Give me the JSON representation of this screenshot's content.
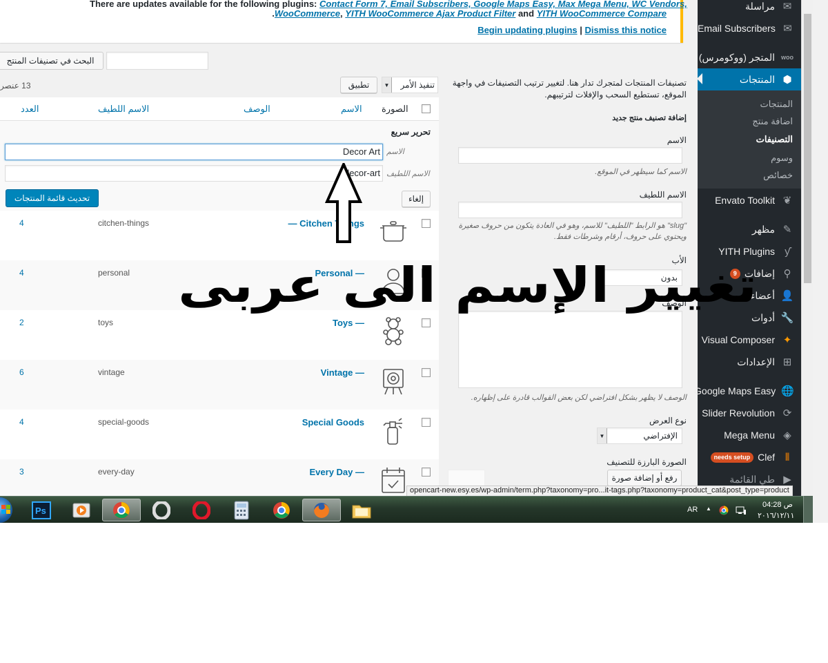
{
  "notice": {
    "line1": "There are updates available for the following plugins:",
    "line1_plugins": "Contact Form 7, Email Subscribers, Google Maps Easy, Max Mega Menu, WC Vendors,",
    "plugin_woocommerce": "WooCommerce",
    "plugin_ajax_filter": "YITH WooCommerce Ajax Product Filter",
    "and": "and",
    "plugin_compare": "YITH WooCommerce Compare",
    "begin_updating": "Begin updating plugins",
    "separator": "|",
    "dismiss": "Dismiss this notice"
  },
  "sidebar": {
    "items": {
      "messages": "مراسلة",
      "email_subscribers": "Email Subscribers",
      "woocommerce": "المتجر (ووكومرس)",
      "products": "المنتجات",
      "envato": "Envato Toolkit",
      "appearance": "مظهر",
      "yith": "YITH Plugins",
      "plugins": "إضافات",
      "plugins_count": "9",
      "users": "أعضاء",
      "tools": "أدوات",
      "visual_composer": "Visual Composer",
      "settings": "الإعدادات",
      "google_maps": "Google Maps Easy",
      "slider_revolution": "Slider Revolution",
      "mega_menu": "Mega Menu",
      "clef": "Clef",
      "clef_badge": "needs setup",
      "collapse": "طي القائمة"
    },
    "submenu": [
      "المنتجات",
      "اضافة منتج",
      "التصنيفات",
      "وسوم",
      "خصائص"
    ],
    "submenu_current": 2
  },
  "add_new": {
    "intro": "تصنيفات المنتجات لمتجرك تدار هنا. لتغيير ترتيب التصنيفات في واجهة الموقع، تستطيع السحب والإفلات لترتيبهم.",
    "heading": "إضافة تصنيف منتج جديد",
    "name_label": "الاسم",
    "name_desc": "الاسم كما سيظهر في الموقع.",
    "slug_label": "الاسم اللطيف",
    "slug_desc": "\"slug\" هو الرابط \"اللطيف\" للاسم، وهو في العادة يتكون من حروف صغيرة ويحتوي على حروف، أرقام وشرطات فقط.",
    "parent_label": "الأب",
    "parent_value": "بدون",
    "description_label": "الوصف",
    "description_desc": "الوصف لا يظهر بشكل افتراضي لكن بعض القوالب قادرة على إظهاره.",
    "display_type_label": "نوع العرض",
    "display_type_value": "الإفتراضي",
    "thumbnail_label": "الصورة البارزة للتصنيف",
    "upload_button": "رفع أو إضافة صورة"
  },
  "list": {
    "search_button": "البحث في تصنيفات المنتج",
    "bulk_action": "تنفيذ الأمر",
    "apply": "تطبيق",
    "count": "13 عنصر",
    "columns": {
      "image": "الصورة",
      "name": "الاسم",
      "description": "الوصف",
      "slug": "الاسم اللطيف",
      "count": "العدد"
    },
    "quick_edit": {
      "title": "تحرير سريع",
      "name_label": "الاسم",
      "name_value": "Decor Art",
      "slug_label": "الاسم اللطيف",
      "slug_value": "decor-art",
      "cancel": "إلغاء",
      "update": "تحديث قائمة المنتجات"
    },
    "rows": [
      {
        "name": "— Citchen Things",
        "slug": "citchen-things",
        "count": "4",
        "icon": "pot-icon"
      },
      {
        "name": "Personal —",
        "slug": "personal",
        "count": "4",
        "icon": "person-icon"
      },
      {
        "name": "Toys —",
        "slug": "toys",
        "count": "2",
        "icon": "teddy-bear-icon"
      },
      {
        "name": "Vintage —",
        "slug": "vintage",
        "count": "6",
        "icon": "vintage-camera-icon"
      },
      {
        "name": "Special Goods",
        "slug": "special-goods",
        "count": "4",
        "icon": "spray-bottle-icon"
      },
      {
        "name": "Every Day —",
        "slug": "every-day",
        "count": "3",
        "icon": "calendar-icon"
      }
    ]
  },
  "overlay": {
    "text": "تغيير الإسم الى عربى"
  },
  "status_url": "opencart-new.esy.es/wp-admin/term.php?taxonomy=pro...it-tags.php?taxonomy=product_cat&post_type=product",
  "taskbar": {
    "language": "AR",
    "time": "ص 04:28",
    "date": "٢٠١٦/١٢/١١"
  },
  "colors": {
    "admin_bar": "#23282d",
    "active_menu": "#0073aa",
    "link": "#0073aa",
    "notice_border": "#ffb900",
    "primary_button": "#0085ba",
    "badge": "#d54e21"
  }
}
